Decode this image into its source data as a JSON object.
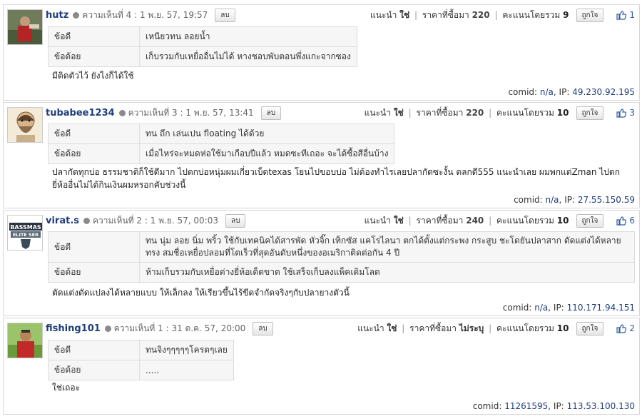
{
  "comments": [
    {
      "username": "hutz",
      "meta": "ความเห็นที่ 4 : 1 พ.ย. 57, 19:57",
      "delete_label": "ลบ",
      "recommend_label": "แนะนำ",
      "recommend_value": "ใช่",
      "price_label": "ราคาที่ซื้อมา",
      "price_value": "220",
      "score_label": "คะแนนโดยรวม",
      "score_value": "9",
      "like_button": "ถูกใจ",
      "like_count": "1",
      "pros_label": "ข้อดี",
      "pros": "เหนียวทน ลอยน้ำ",
      "cons_label": "ข้อด้อย",
      "cons": "เก็บรวมกับเหยื่ออื่นไม่ได้ หางชอบพับตอนพึ่งแกะจากซอง",
      "text": "มีติดตัวไว้ ยังไงก็ได้ใช้",
      "comid_label": "comid:",
      "comid": "n/a",
      "ip_label": "IP:",
      "ip": "49.230.92.195"
    },
    {
      "username": "tubabee1234",
      "meta": "ความเห็นที่ 3 : 1 พ.ย. 57, 13:41",
      "delete_label": "ลบ",
      "recommend_label": "แนะนำ",
      "recommend_value": "ใช่",
      "price_label": "ราคาที่ซื้อมา",
      "price_value": "220",
      "score_label": "คะแนนโดยรวม",
      "score_value": "10",
      "like_button": "ถูกใจ",
      "like_count": "3",
      "pros_label": "ข้อดี",
      "pros": "ทน ถึก เล่นเปน floating ได้ด้วย",
      "cons_label": "ข้อด้อย",
      "cons": "เมื่อไหร่จะหมดห่อใช้มาเกือบปีแล้ว หมดซะทีเถอะ จะได้ซื้อสีอื่นบ้าง",
      "text": "ปลากัดทุกบ่อ ธรรมชาติก็ใช้ดีมาก ไปตกบ่อหนุ่มผมเกี่ยวเบ็ดtexas โยนไปขอบบ่อ ไม่ต้องทำไรเลยปลากัดซะงั้น ตลกดี555 แนะนำเลย ผมพกแต่Zman ไปตกยี่ห้ออื่นไม่ได้กินเงินผมหรอกคับช่วงนี้",
      "comid_label": "comid:",
      "comid": "n/a",
      "ip_label": "IP:",
      "ip": "27.55.150.59"
    },
    {
      "username": "virat.s",
      "meta": "ความเห็นที่ 2 : 1 พ.ย. 57, 00:03",
      "delete_label": "ลบ",
      "recommend_label": "แนะนำ",
      "recommend_value": "ใช่",
      "price_label": "ราคาที่ซื้อมา",
      "price_value": "240",
      "score_label": "คะแนนโดยรวม",
      "score_value": "10",
      "like_button": "ถูกใจ",
      "like_count": "6",
      "pros_label": "ข้อดี",
      "pros": "ทน นุ่ม ลอย นิ่ม พริ้ว ใช้กับเทคนิคได้สารพัด หัวจิ๊ก เท็กซัส แคโรไลนา ตกได้ตั้งแต่กระพง กระสูบ ชะโดยันปลาสาก ดัดแต่งได้หลายทรง สมชื่อเหยื่อปลอมที่โตเร็วที่สุดอันดับหนึ่งของอเมริกาติดต่อกัน 4 ปี",
      "cons_label": "ข้อด้อย",
      "cons": "ห้ามเก็บรวมกับเหยื่อต่างยี่ห้อเด็ดขาด ใช้เสร็จเก็บลงแพ็คเดิมโลด",
      "text": "ตัดแต่งดัดแปลงได้หลายแบบ ให้เล็กลง ให้เรียวขึ้นไร้ขีดจำกัดจริงๆกับปลายางตัวนี้",
      "comid_label": "comid:",
      "comid": "n/a",
      "ip_label": "IP:",
      "ip": "110.171.94.151",
      "avatar_text_top": "BASSMAS",
      "avatar_text_bottom": "ELITE SER"
    },
    {
      "username": "fishing101",
      "meta": "ความเห็นที่ 1 : 31 ต.ค. 57, 20:00",
      "delete_label": "ลบ",
      "recommend_label": "แนะนำ",
      "recommend_value": "ใช่",
      "price_label": "ราคาที่ซื้อมา",
      "price_value": "ไม่ระบุ",
      "score_label": "คะแนนโดยรวม",
      "score_value": "10",
      "like_button": "ถูกใจ",
      "like_count": "2",
      "pros_label": "ข้อดี",
      "pros": "ทนจิงๆๆๆๆๆโครตๆเลย",
      "cons_label": "ข้อด้อย",
      "cons": ".....",
      "text": "ใช่เถอะ",
      "comid_label": "comid:",
      "comid": "11261595",
      "ip_label": "IP:",
      "ip": "113.53.100.130"
    }
  ],
  "colors": {
    "username": "#1f3d7a",
    "border": "#d8d8d8",
    "table_bg": "#f6f6f6",
    "like_blue": "#2f5aa0"
  }
}
